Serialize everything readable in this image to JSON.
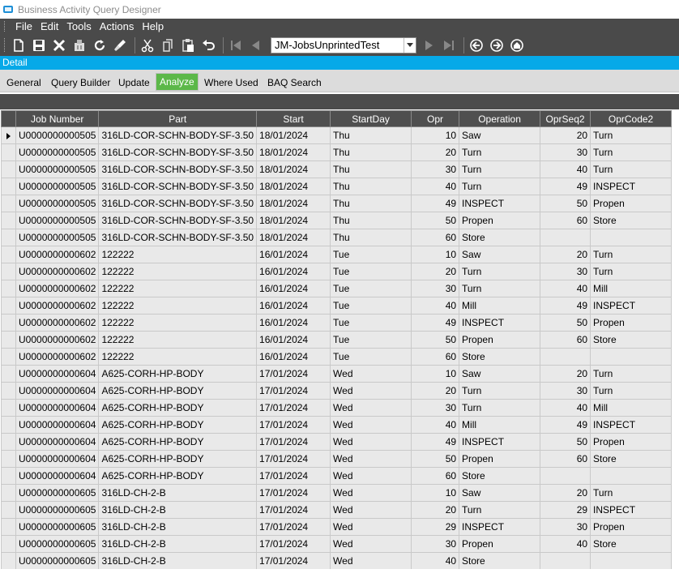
{
  "window": {
    "title": "Business Activity Query Designer"
  },
  "menu": [
    "File",
    "Edit",
    "Tools",
    "Actions",
    "Help"
  ],
  "toolbar": {
    "icons": [
      "new-icon",
      "save-icon",
      "delete-icon",
      "attach-icon",
      "refresh-icon",
      "clear-icon",
      "cut-icon",
      "copy-icon",
      "paste-icon",
      "undo-icon"
    ],
    "query_selector_value": "JM-JobsUnprintedTest",
    "nav_icons": [
      "first-record-icon",
      "previous-record-icon",
      "next-record-icon",
      "last-record-icon"
    ],
    "right_icons": [
      "back-icon",
      "forward-icon",
      "home-icon"
    ]
  },
  "detail_label": "Detail",
  "tabs": [
    "General",
    "Query Builder",
    "Update",
    "Analyze",
    "Where Used",
    "BAQ Search"
  ],
  "active_tab": "Analyze",
  "colors": {
    "accent": "#06a9e8",
    "active_tab": "#5cb849",
    "header": "#4f4f4f",
    "menubar": "#4a4a4a"
  },
  "grid": {
    "columns": [
      "Job Number",
      "Part",
      "Start",
      "StartDay",
      "Opr",
      "Operation",
      "OprSeq2",
      "OprCode2"
    ],
    "rows": [
      [
        "U0000000000505",
        "316LD-COR-SCHN-BODY-SF-3.50",
        "18/01/2024",
        "Thu",
        "10",
        "Saw",
        "20",
        "Turn"
      ],
      [
        "U0000000000505",
        "316LD-COR-SCHN-BODY-SF-3.50",
        "18/01/2024",
        "Thu",
        "20",
        "Turn",
        "30",
        "Turn"
      ],
      [
        "U0000000000505",
        "316LD-COR-SCHN-BODY-SF-3.50",
        "18/01/2024",
        "Thu",
        "30",
        "Turn",
        "40",
        "Turn"
      ],
      [
        "U0000000000505",
        "316LD-COR-SCHN-BODY-SF-3.50",
        "18/01/2024",
        "Thu",
        "40",
        "Turn",
        "49",
        "INSPECT"
      ],
      [
        "U0000000000505",
        "316LD-COR-SCHN-BODY-SF-3.50",
        "18/01/2024",
        "Thu",
        "49",
        "INSPECT",
        "50",
        "Propen"
      ],
      [
        "U0000000000505",
        "316LD-COR-SCHN-BODY-SF-3.50",
        "18/01/2024",
        "Thu",
        "50",
        "Propen",
        "60",
        "Store"
      ],
      [
        "U0000000000505",
        "316LD-COR-SCHN-BODY-SF-3.50",
        "18/01/2024",
        "Thu",
        "60",
        "Store",
        "",
        ""
      ],
      [
        "U0000000000602",
        "122222",
        "16/01/2024",
        "Tue",
        "10",
        "Saw",
        "20",
        "Turn"
      ],
      [
        "U0000000000602",
        "122222",
        "16/01/2024",
        "Tue",
        "20",
        "Turn",
        "30",
        "Turn"
      ],
      [
        "U0000000000602",
        "122222",
        "16/01/2024",
        "Tue",
        "30",
        "Turn",
        "40",
        "Mill"
      ],
      [
        "U0000000000602",
        "122222",
        "16/01/2024",
        "Tue",
        "40",
        "Mill",
        "49",
        "INSPECT"
      ],
      [
        "U0000000000602",
        "122222",
        "16/01/2024",
        "Tue",
        "49",
        "INSPECT",
        "50",
        "Propen"
      ],
      [
        "U0000000000602",
        "122222",
        "16/01/2024",
        "Tue",
        "50",
        "Propen",
        "60",
        "Store"
      ],
      [
        "U0000000000602",
        "122222",
        "16/01/2024",
        "Tue",
        "60",
        "Store",
        "",
        ""
      ],
      [
        "U0000000000604",
        "A625-CORH-HP-BODY",
        "17/01/2024",
        "Wed",
        "10",
        "Saw",
        "20",
        "Turn"
      ],
      [
        "U0000000000604",
        "A625-CORH-HP-BODY",
        "17/01/2024",
        "Wed",
        "20",
        "Turn",
        "30",
        "Turn"
      ],
      [
        "U0000000000604",
        "A625-CORH-HP-BODY",
        "17/01/2024",
        "Wed",
        "30",
        "Turn",
        "40",
        "Mill"
      ],
      [
        "U0000000000604",
        "A625-CORH-HP-BODY",
        "17/01/2024",
        "Wed",
        "40",
        "Mill",
        "49",
        "INSPECT"
      ],
      [
        "U0000000000604",
        "A625-CORH-HP-BODY",
        "17/01/2024",
        "Wed",
        "49",
        "INSPECT",
        "50",
        "Propen"
      ],
      [
        "U0000000000604",
        "A625-CORH-HP-BODY",
        "17/01/2024",
        "Wed",
        "50",
        "Propen",
        "60",
        "Store"
      ],
      [
        "U0000000000604",
        "A625-CORH-HP-BODY",
        "17/01/2024",
        "Wed",
        "60",
        "Store",
        "",
        ""
      ],
      [
        "U0000000000605",
        "316LD-CH-2-B",
        "17/01/2024",
        "Wed",
        "10",
        "Saw",
        "20",
        "Turn"
      ],
      [
        "U0000000000605",
        "316LD-CH-2-B",
        "17/01/2024",
        "Wed",
        "20",
        "Turn",
        "29",
        "INSPECT"
      ],
      [
        "U0000000000605",
        "316LD-CH-2-B",
        "17/01/2024",
        "Wed",
        "29",
        "INSPECT",
        "30",
        "Propen"
      ],
      [
        "U0000000000605",
        "316LD-CH-2-B",
        "17/01/2024",
        "Wed",
        "30",
        "Propen",
        "40",
        "Store"
      ],
      [
        "U0000000000605",
        "316LD-CH-2-B",
        "17/01/2024",
        "Wed",
        "40",
        "Store",
        "",
        ""
      ]
    ]
  }
}
